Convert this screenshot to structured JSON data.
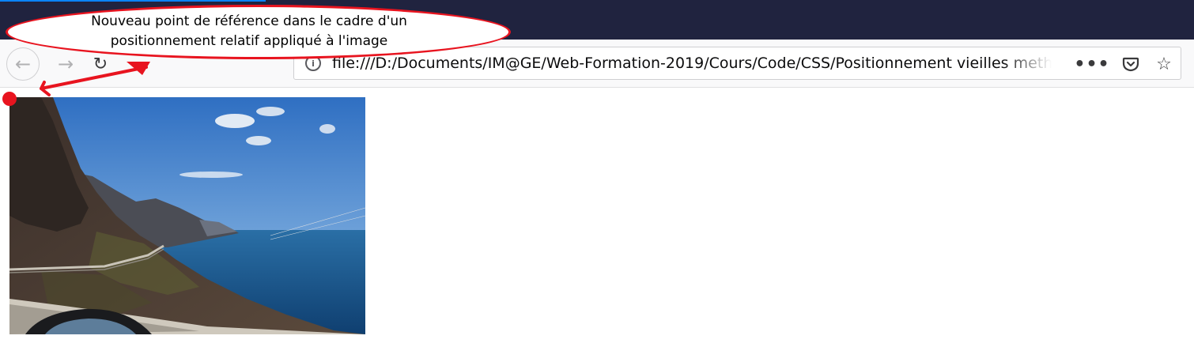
{
  "browser": {
    "url": "file:///D:/Documents/IM@GE/Web-Formation-2019/Cours/Code/CSS/Positionnement vieilles methodes/index.html",
    "icons": {
      "back": "back-arrow-icon",
      "forward": "forward-arrow-icon",
      "reload": "reload-icon",
      "info": "page-info-icon",
      "more": "page-actions-more-icon",
      "pocket": "pocket-icon",
      "bookmark": "bookmark-star-icon"
    },
    "colors": {
      "titlebar": "#20233f",
      "accent": "#0a84ff",
      "toolbar": "#f9f9fa"
    }
  },
  "annotation": {
    "text_line1": "Nouveau point de référence dans le cadre d'un",
    "text_line2": "positionnement relatif appliqué à l'image",
    "color": "#e8141f"
  },
  "content": {
    "image": "coastal-mountain-road-photo"
  }
}
